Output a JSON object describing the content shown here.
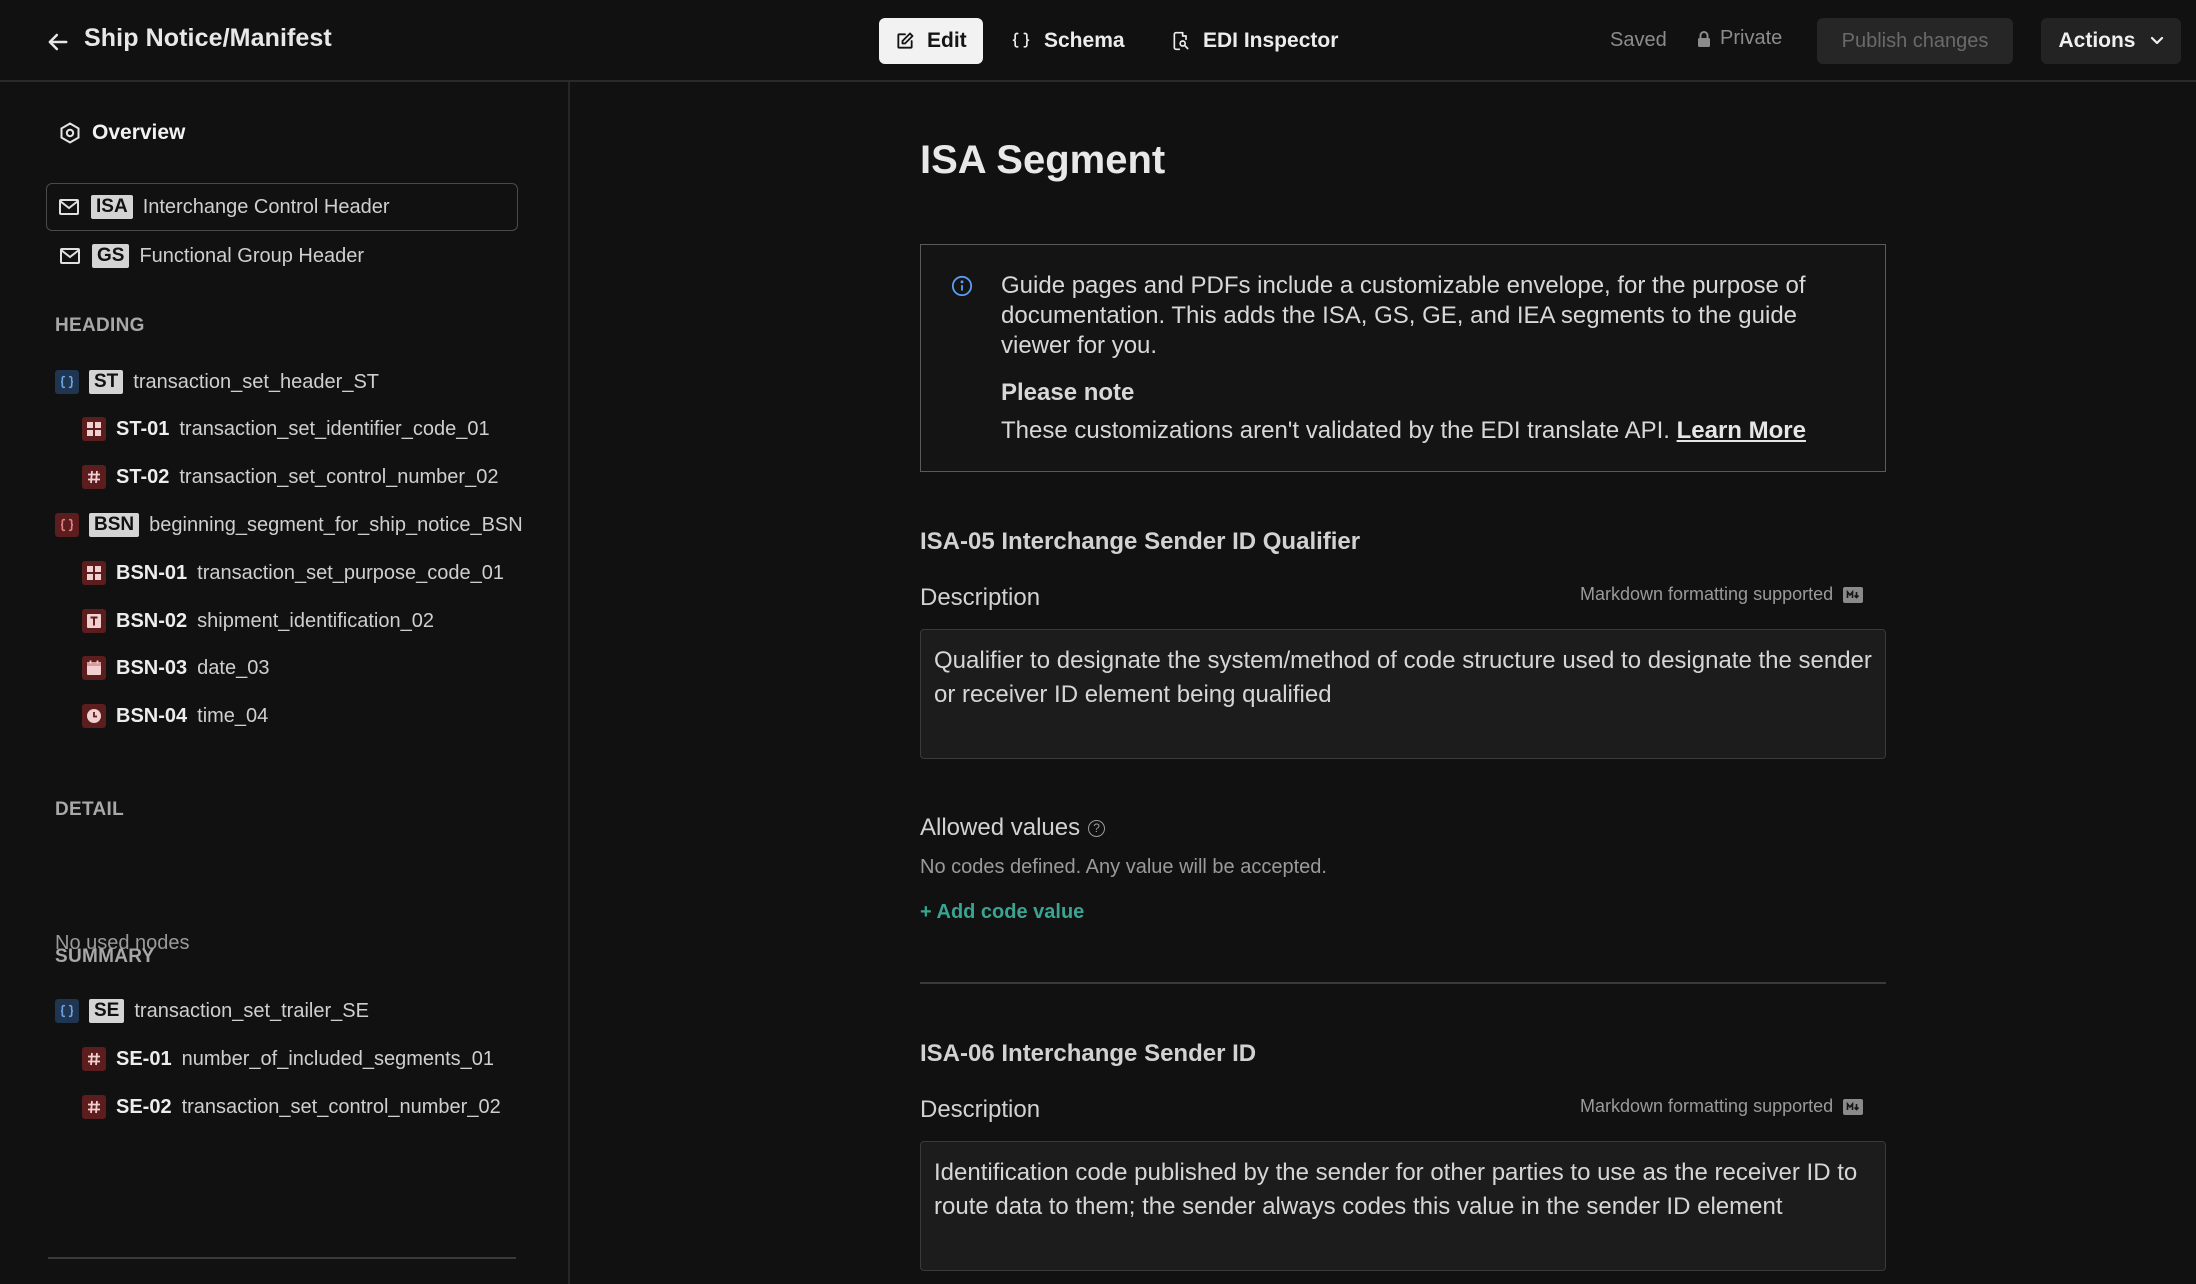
{
  "header": {
    "title": "Ship Notice/Manifest",
    "tabs": [
      {
        "label": "Edit",
        "active": true,
        "icon": "edit-icon"
      },
      {
        "label": "Schema",
        "active": false,
        "icon": "braces-icon"
      },
      {
        "label": "EDI Inspector",
        "active": false,
        "icon": "inspect-icon"
      }
    ],
    "saved": "Saved",
    "private": "Private",
    "publish": "Publish changes",
    "actions": "Actions"
  },
  "sidebar": {
    "overview": "Overview",
    "envelope": [
      {
        "tag": "ISA",
        "label": "Interchange Control Header",
        "selected": true
      },
      {
        "tag": "GS",
        "label": "Functional Group Header",
        "selected": false
      }
    ],
    "heading_title": "HEADING",
    "heading": [
      {
        "tag": "ST",
        "label": "transaction_set_header_ST",
        "icon": "braces-icon",
        "color": "blue"
      },
      {
        "code": "ST-01",
        "label": "transaction_set_identifier_code_01",
        "icon": "grid-icon"
      },
      {
        "code": "ST-02",
        "label": "transaction_set_control_number_02",
        "icon": "hash-icon"
      },
      {
        "tag": "BSN",
        "label": "beginning_segment_for_ship_notice_BSN",
        "icon": "braces-icon",
        "color": "red"
      },
      {
        "code": "BSN-01",
        "label": "transaction_set_purpose_code_01",
        "icon": "grid-icon"
      },
      {
        "code": "BSN-02",
        "label": "shipment_identification_02",
        "icon": "text-icon"
      },
      {
        "code": "BSN-03",
        "label": "date_03",
        "icon": "calendar-icon"
      },
      {
        "code": "BSN-04",
        "label": "time_04",
        "icon": "clock-icon"
      }
    ],
    "detail_title": "DETAIL",
    "detail_empty": "No used nodes",
    "summary_title": "SUMMARY",
    "summary": [
      {
        "tag": "SE",
        "label": "transaction_set_trailer_SE",
        "icon": "braces-icon",
        "color": "blue"
      },
      {
        "code": "SE-01",
        "label": "number_of_included_segments_01",
        "icon": "hash-icon"
      },
      {
        "code": "SE-02",
        "label": "transaction_set_control_number_02",
        "icon": "hash-icon"
      }
    ]
  },
  "main": {
    "title": "ISA Segment",
    "info": {
      "text": "Guide pages and PDFs include a customizable envelope, for the purpose of documentation. This adds the ISA, GS, GE, and IEA segments to the guide viewer for you.",
      "note_title": "Please note",
      "note_text": "These customizations aren't validated by the EDI translate API.",
      "learn_more": "Learn More"
    },
    "fields": [
      {
        "title": "ISA-05 Interchange Sender ID Qualifier",
        "description_label": "Description",
        "markdown_hint": "Markdown formatting supported",
        "description": "Qualifier to designate the system/method of code structure used to designate the sender or receiver ID element being qualified",
        "allowed_label": "Allowed values",
        "no_codes": "No codes defined. Any value will be accepted.",
        "add_code": "+ Add code value"
      },
      {
        "title": "ISA-06 Interchange Sender ID",
        "description_label": "Description",
        "markdown_hint": "Markdown formatting supported",
        "description": "Identification code published by the sender for other parties to use as the receiver ID to route data to them; the sender always codes this value in the sender ID element"
      }
    ]
  }
}
